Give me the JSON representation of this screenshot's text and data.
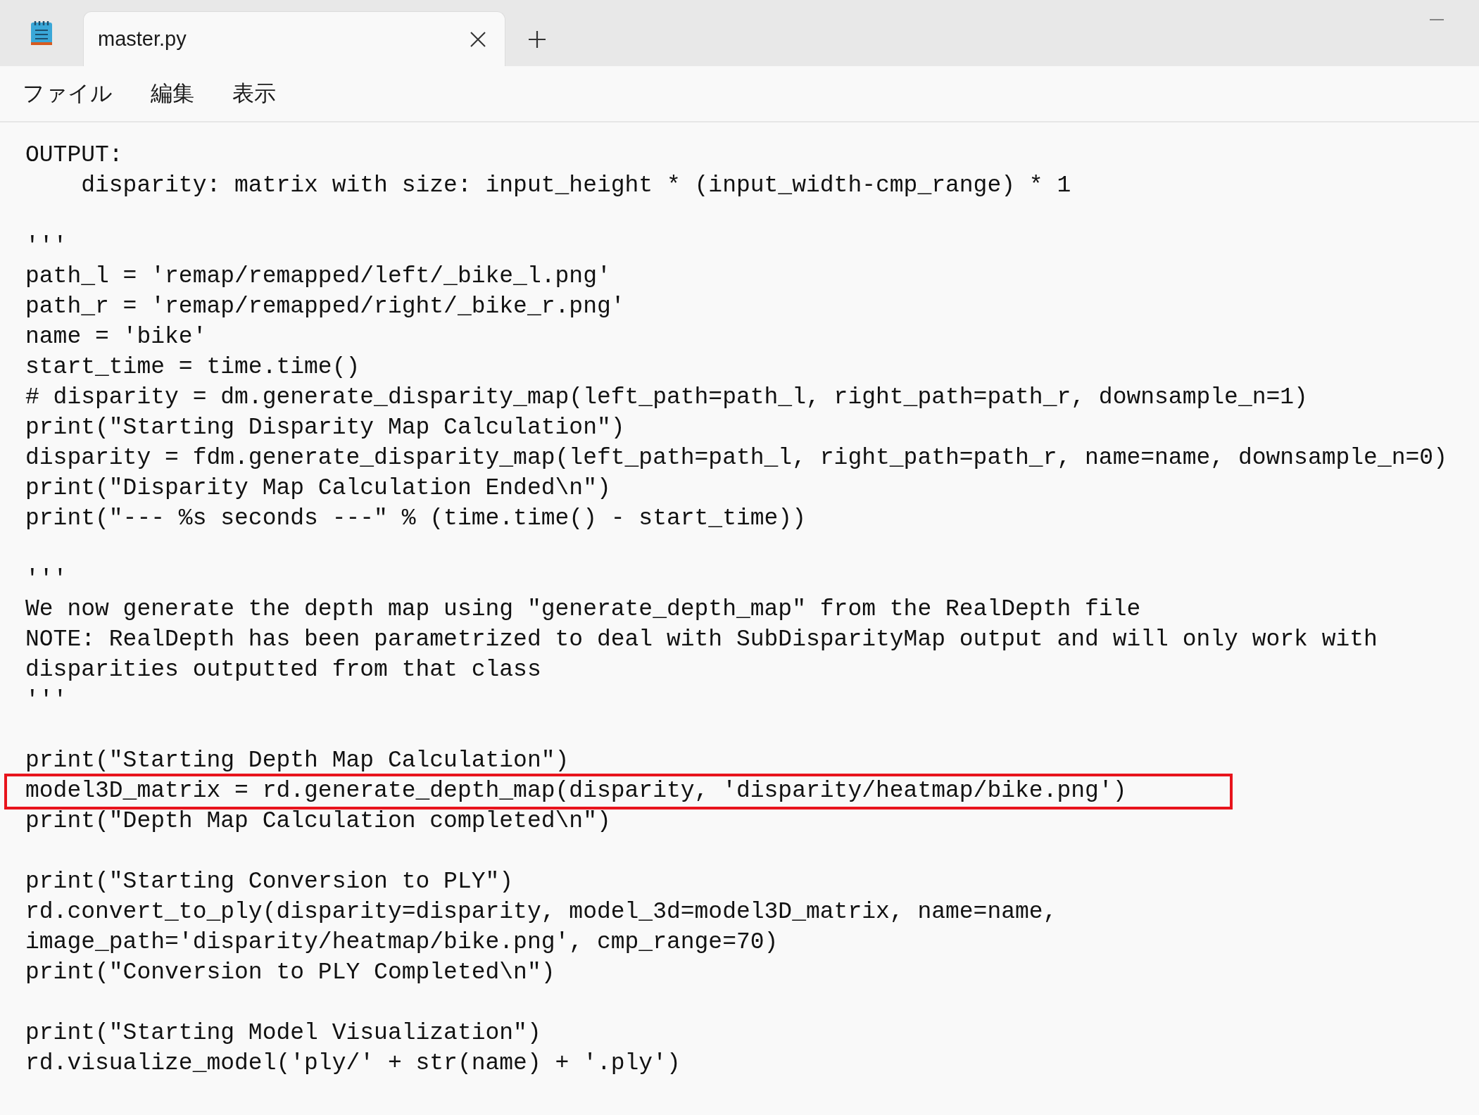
{
  "window": {
    "tabs": [
      {
        "title": "master.py",
        "selected": true
      }
    ]
  },
  "menu": [
    {
      "label": "ファイル"
    },
    {
      "label": "編集"
    },
    {
      "label": "表示"
    }
  ],
  "lines": [
    {
      "kind": "code",
      "text": "OUTPUT:",
      "highlighted": false
    },
    {
      "kind": "code",
      "text": "    disparity: matrix with size: input_height * (input_width-cmp_range) * 1",
      "highlighted": false
    },
    {
      "kind": "blank"
    },
    {
      "kind": "code",
      "text": "'''",
      "highlighted": false
    },
    {
      "kind": "code",
      "text": "path_l = 'remap/remapped/left/_bike_l.png'",
      "highlighted": false
    },
    {
      "kind": "code",
      "text": "path_r = 'remap/remapped/right/_bike_r.png'",
      "highlighted": false
    },
    {
      "kind": "code",
      "text": "name = 'bike'",
      "highlighted": false
    },
    {
      "kind": "code",
      "text": "start_time = time.time()",
      "highlighted": false
    },
    {
      "kind": "code",
      "text": "# disparity = dm.generate_disparity_map(left_path=path_l, right_path=path_r, downsample_n=1)",
      "highlighted": false
    },
    {
      "kind": "code",
      "text": "print(\"Starting Disparity Map Calculation\")",
      "highlighted": false
    },
    {
      "kind": "code",
      "text": "disparity = fdm.generate_disparity_map(left_path=path_l, right_path=path_r, name=name, downsample_n=0)",
      "highlighted": false
    },
    {
      "kind": "code",
      "text": "print(\"Disparity Map Calculation Ended\\n\")",
      "highlighted": false
    },
    {
      "kind": "code",
      "text": "print(\"--- %s seconds ---\" % (time.time() - start_time))",
      "highlighted": false
    },
    {
      "kind": "blank"
    },
    {
      "kind": "code",
      "text": "'''",
      "highlighted": false
    },
    {
      "kind": "code",
      "text": "We now generate the depth map using \"generate_depth_map\" from the RealDepth file",
      "highlighted": false
    },
    {
      "kind": "code",
      "text": "NOTE: RealDepth has been parametrized to deal with SubDisparityMap output and will only work with",
      "highlighted": false
    },
    {
      "kind": "code",
      "text": "disparities outputted from that class",
      "highlighted": false
    },
    {
      "kind": "code",
      "text": "'''",
      "highlighted": false
    },
    {
      "kind": "blank"
    },
    {
      "kind": "code",
      "text": "print(\"Starting Depth Map Calculation\")",
      "highlighted": false
    },
    {
      "kind": "code",
      "text": "model3D_matrix = rd.generate_depth_map(disparity, 'disparity/heatmap/bike.png')",
      "highlighted": true
    },
    {
      "kind": "code",
      "text": "print(\"Depth Map Calculation completed\\n\")",
      "highlighted": false
    },
    {
      "kind": "blank"
    },
    {
      "kind": "code",
      "text": "print(\"Starting Conversion to PLY\")",
      "highlighted": false
    },
    {
      "kind": "code",
      "text": "rd.convert_to_ply(disparity=disparity, model_3d=model3D_matrix, name=name,",
      "highlighted": false
    },
    {
      "kind": "code",
      "text": "image_path='disparity/heatmap/bike.png', cmp_range=70)",
      "highlighted": false
    },
    {
      "kind": "code",
      "text": "print(\"Conversion to PLY Completed\\n\")",
      "highlighted": false
    },
    {
      "kind": "blank"
    },
    {
      "kind": "code",
      "text": "print(\"Starting Model Visualization\")",
      "highlighted": false
    },
    {
      "kind": "code",
      "text": "rd.visualize_model('ply/' + str(name) + '.ply')",
      "highlighted": false
    }
  ]
}
